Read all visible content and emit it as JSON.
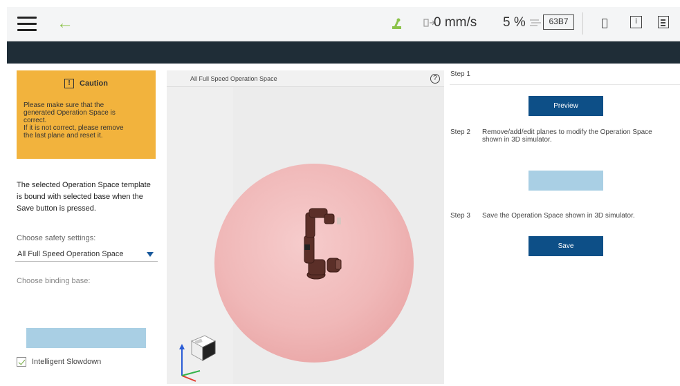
{
  "topbar": {
    "speed": "0 mm/s",
    "speed_override": "5 %",
    "controller_id": "63B7",
    "info_icon_glyph": "i",
    "accent_color": "#8bc34a"
  },
  "caution": {
    "title": "Caution",
    "icon_glyph": "!",
    "lines": [
      "Please make sure that the",
      "generated Operation Space is",
      "correct.",
      "If it is not correct, please remove",
      "the last plane and reset it."
    ],
    "color": "#f2b33d"
  },
  "left": {
    "bound_lines": [
      "The selected Operation Space template",
      "is bound with selected base when the",
      "Save button is pressed."
    ],
    "safety_label": "Choose safety settings:",
    "safety_value": "All Full Speed Operation Space",
    "binding_label": "Choose binding base:",
    "binding_value": "",
    "update_label": "",
    "slowdown_label": "Intelligent Slowdown",
    "slowdown_checked": true
  },
  "simulator": {
    "title": "All Full Speed Operation Space",
    "help_glyph": "?"
  },
  "steps": {
    "step1_label": "Step 1",
    "preview_label": "Preview",
    "step2_label": "Step 2",
    "step2_lines": [
      "Remove/add/edit planes to modify the Operation Space",
      "shown in 3D simulator."
    ],
    "edit_label": "",
    "step3_label": "Step 3",
    "step3_text": "Save the Operation Space shown in 3D simulator.",
    "save_label": "Save",
    "primary_color": "#0d4f87",
    "disabled_color": "#a9cfe4"
  },
  "icons": {
    "menu": "hamburger-menu-icon",
    "back": "back-arrow-icon",
    "robot_status": "robot-status-icon",
    "speed": "speed-icon",
    "battery": "battery-icon",
    "info": "info-icon",
    "doc": "document-icon",
    "help": "help-icon",
    "caution": "caution-icon",
    "view_cube": "view-cube-icon",
    "axes": "axes-icon"
  }
}
